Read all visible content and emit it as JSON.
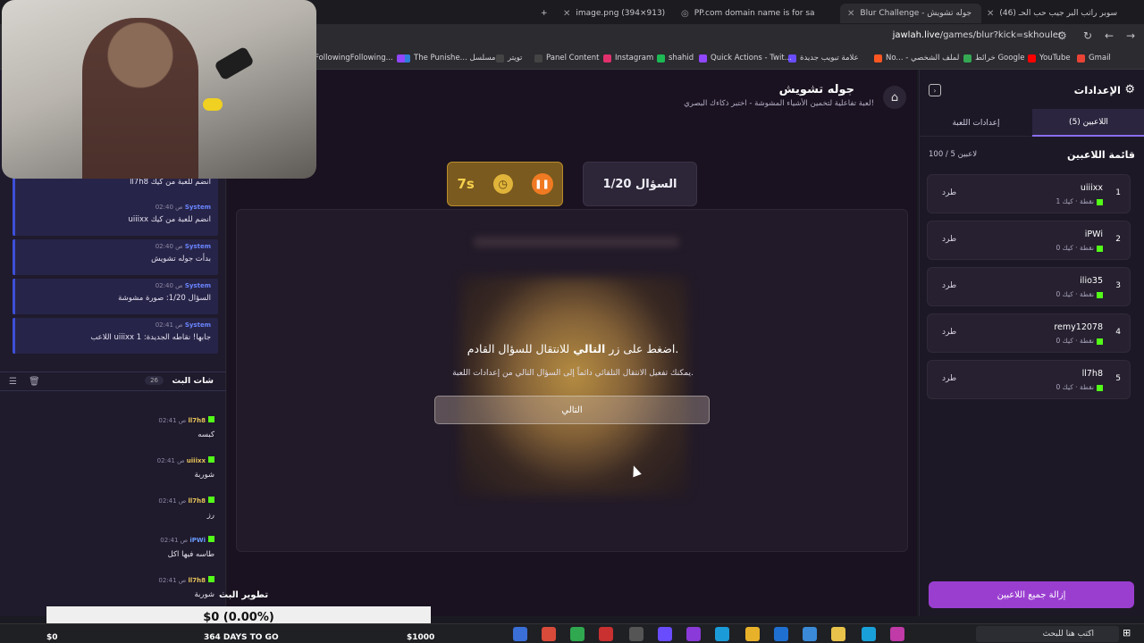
{
  "browser": {
    "tabs": [
      {
        "title": "image.png (394×913)",
        "active": false
      },
      {
        "title": "PP.com domain name is for sale",
        "active": false
      },
      {
        "title": "Blur Challenge - جوله تشويش",
        "active": true
      },
      {
        "title": "(46) سوبر راتب البر جيب حب الحـ",
        "active": false
      }
    ],
    "url_host": "jawlah.live",
    "url_path": "/games/blur?kick=skhouler",
    "bookmarks": [
      {
        "label": "Gmail",
        "color": "#ea4335"
      },
      {
        "label": "YouTube",
        "color": "#ff0000"
      },
      {
        "label": "خرائط Google",
        "color": "#34a853"
      },
      {
        "label": "No... - لملف الشخصي",
        "color": "#ff5722"
      },
      {
        "label": "علامة تبويب جديدة",
        "color": "#6a4cff"
      },
      {
        "label": "Quick Actions - Twit...",
        "color": "#9146ff"
      },
      {
        "label": "shahid",
        "color": "#1db954"
      },
      {
        "label": "Instagram",
        "color": "#e1306c"
      },
      {
        "label": "Panel Content",
        "color": "#444444"
      },
      {
        "label": "تويتر",
        "color": "#444444"
      },
      {
        "label": "The Punishe... مسلسل",
        "color": "#2e7dd7"
      },
      {
        "label": "FollowingFollowing...",
        "color": "#9146ff"
      }
    ]
  },
  "chat": {
    "system_label": "System",
    "system_messages": [
      {
        "time": "02:40 ص",
        "text": "ll7h8 انضم للعبة من كيك"
      },
      {
        "time": "02:40 ص",
        "text": "uiiixx انضم للعبة من كيك"
      },
      {
        "time": "02:40 ص",
        "text": "بدأت جوله تشويش"
      },
      {
        "time": "02:40 ص",
        "text": "السؤال 1/20: صورة مشوشة"
      },
      {
        "time": "02:41 ص",
        "text": "اللاعب uiiixx جابها! نقاطه الجديدة: 1"
      }
    ],
    "title": "شات البث",
    "count": "26",
    "messages": [
      {
        "user": "ll7h8",
        "time": "02:41 ص",
        "text": "كبسه",
        "color": "#e6c45a"
      },
      {
        "user": "uiiixx",
        "time": "02:41 ص",
        "text": "شوربة",
        "color": "#e6c45a"
      },
      {
        "user": "ll7h8",
        "time": "02:41 ص",
        "text": "رز",
        "color": "#e6c45a"
      },
      {
        "user": "iPWi",
        "time": "02:41 ص",
        "text": "طاسه فيها اكل",
        "color": "#6a9cff"
      },
      {
        "user": "ll7h8",
        "time": "02:41 ص",
        "text": "شوربة",
        "color": "#e6c45a"
      }
    ]
  },
  "game": {
    "title": "جوله تشويش",
    "subtitle": "لعبة تفاعلية لتخمين الأشياء المشوشة - اختبر ذكاءك البصري!",
    "timer": "7s",
    "question": "السؤال 1/20",
    "prompt_pre": "اضغط على زر ",
    "prompt_bold": "التالي",
    "prompt_post": " للانتقال للسؤال القادم.",
    "hint": "يمكنك تفعيل الانتقال التلقائي دائماً إلى السؤال التالي من إعدادات اللعبة.",
    "next_label": "التالي"
  },
  "settings": {
    "title": "الإعدادات",
    "tab_players": "اللاعبين (5)",
    "tab_game": "إعدادات اللعبة",
    "list_title": "قائمة اللاعبين",
    "capacity": "100 / 5 لاعبين",
    "kick_label": "طرد",
    "platform": "كيك",
    "players": [
      {
        "rank": "1",
        "name": "uiiixx",
        "points": "1 نقطة"
      },
      {
        "rank": "2",
        "name": "iPWi",
        "points": "0 نقطة"
      },
      {
        "rank": "3",
        "name": "ilio35",
        "points": "0 نقطة"
      },
      {
        "rank": "4",
        "name": "remy12078",
        "points": "0 نقطة"
      },
      {
        "rank": "5",
        "name": "ll7h8",
        "points": "0 نقطة"
      }
    ],
    "remove_all": "إزالة جميع اللاعبين"
  },
  "overlay": {
    "donation_title": "تطوير البث",
    "donation_value": "$0 (0.00%)",
    "goal_start": "$0",
    "goal_days": "364 DAYS TO GO",
    "goal_end": "$1000"
  },
  "taskbar": {
    "search_placeholder": "اكتب هنا للبحث"
  },
  "colors": {
    "accent": "#9a3ed0",
    "kick_green": "#53fc18",
    "timer_gold": "#f6d04c"
  }
}
